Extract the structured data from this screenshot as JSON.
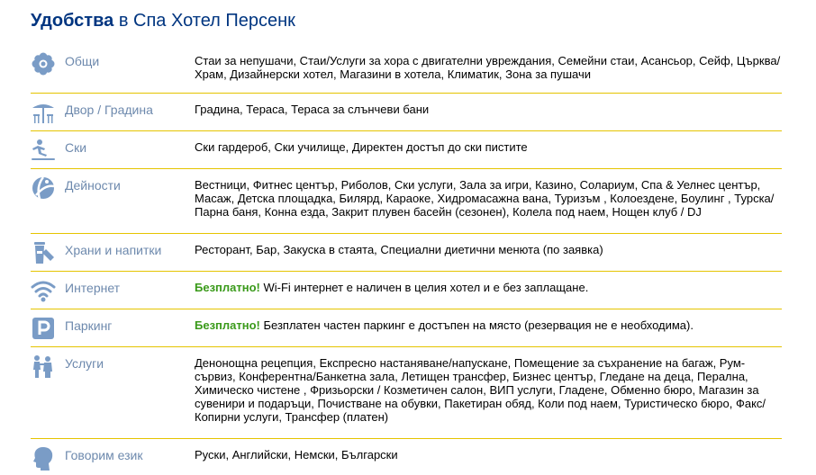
{
  "header": {
    "title_bold": "Удобства",
    "title_rest": " в Спа Хотел Персенк"
  },
  "colors": {
    "title": "#003580",
    "category": "#6d89ad",
    "icon": "#7a9cc6",
    "divider": "#e5c400",
    "free": "#3a9a1a"
  },
  "amenities": [
    {
      "icon": "flower-icon",
      "label": "Общи",
      "text": "Стаи за непушачи, Стаи/Услуги за хора с двигателни увреждания, Семейни стаи, Асансьор, Сейф, Църква/ Храм, Дизайнерски хотел, Магазини в хотела, Климатик, Зона за пушачи"
    },
    {
      "icon": "patio-umbrella-icon",
      "label": "Двор / Градина",
      "text": "Градина, Тераса, Тераса за слънчеви бани"
    },
    {
      "icon": "skier-icon",
      "label": "Ски",
      "text": "Ски гардероб, Ски училище, Директен достъп до ски пистите"
    },
    {
      "icon": "beach-ball-icon",
      "label": "Дейности",
      "text": "Вестници, Фитнес център, Риболов, Ски услуги, Зала за игри, Казино, Солариум, Спа & Уелнес център, Масаж, Детска площадка, Билярд, Караоке, Хидромасажна вана, Туризъм , Колоездене, Боулинг , Турска/ Парна баня, Конна езда, Закрит плувен басейн (сезонен), Колела под наем, Нощен клуб / DJ"
    },
    {
      "icon": "food-drink-icon",
      "label": "Храни и напитки",
      "text": "Ресторант, Бар, Закуска в стаята, Специални диетични менюта (по заявка)"
    },
    {
      "icon": "wifi-icon",
      "label": "Интернет",
      "free": "Безплатно!",
      "text": " Wi-Fi интернет е наличен в целия хотел и е без заплащане."
    },
    {
      "icon": "parking-icon",
      "label": "Паркинг",
      "free": "Безплатно!",
      "text": " Безплатен частен паркинг е достъпен на място (резервация не е необходима)."
    },
    {
      "icon": "concierge-icon",
      "label": "Услуги",
      "text": "Денонощна рецепция, Експресно настаняване/напускане, Помещение за съхранение на багаж, Рум-сървиз, Конферентна/Банкетна зала, Летищен трансфер, Бизнес център, Гледане на деца, Перална, Химическо чистене , Фризьорски / Козметичен салон, ВИП услуги, Гладене, Обменно бюро, Магазин за сувенири и подаръци, Почистване на обувки, Пакетиран обяд, Коли под наем, Туристическо бюро, Факс/ Копирни услуги, Трансфер (платен)"
    },
    {
      "icon": "speaking-head-icon",
      "label": "Говорим език",
      "text": "Руски, Английски, Немски, Български"
    }
  ]
}
